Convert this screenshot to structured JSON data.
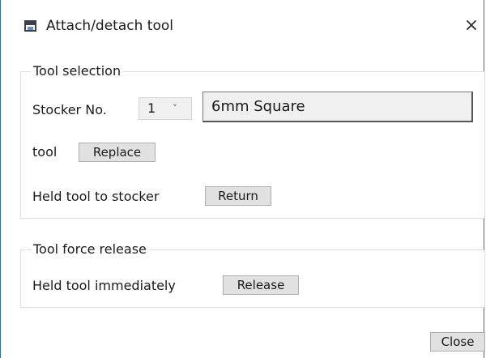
{
  "window": {
    "title": "Attach/detach tool",
    "close_glyph": "×"
  },
  "tool_selection": {
    "legend": "Tool selection",
    "stocker_label": "Stocker No.",
    "stocker_value": "1",
    "stocker_chevron": "˅",
    "tool_name": "6mm Square",
    "tool_label": "tool",
    "replace_button": "Replace",
    "held_to_stocker_label": "Held tool to stocker",
    "return_button": "Return"
  },
  "tool_force_release": {
    "legend": "Tool force release",
    "held_immediately_label": "Held tool immediately",
    "release_button": "Release"
  },
  "footer": {
    "close_button": "Close"
  },
  "icons": {
    "app": "window-app-icon",
    "close": "close-icon",
    "dropdown": "chevron-down-icon"
  }
}
